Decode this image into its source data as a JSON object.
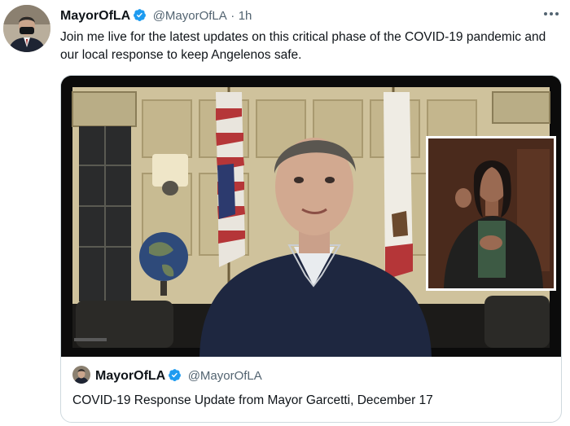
{
  "tweet": {
    "display_name": "MayorOfLA",
    "handle": "@MayorOfLA",
    "separator": "·",
    "time": "1h",
    "text": "Join me live for the latest updates on this critical phase of the COVID-19 pandemic and our local response to keep Angelenos safe."
  },
  "quoted": {
    "display_name": "MayorOfLA",
    "handle": "@MayorOfLA",
    "title": "COVID-19 Response Update from Mayor Garcetti, December 17"
  },
  "icons": {
    "verified": "verified-badge-icon",
    "more": "more-options-icon"
  },
  "colors": {
    "verified": "#1d9bf0",
    "secondary_text": "#536471",
    "border": "#cfd9de"
  }
}
